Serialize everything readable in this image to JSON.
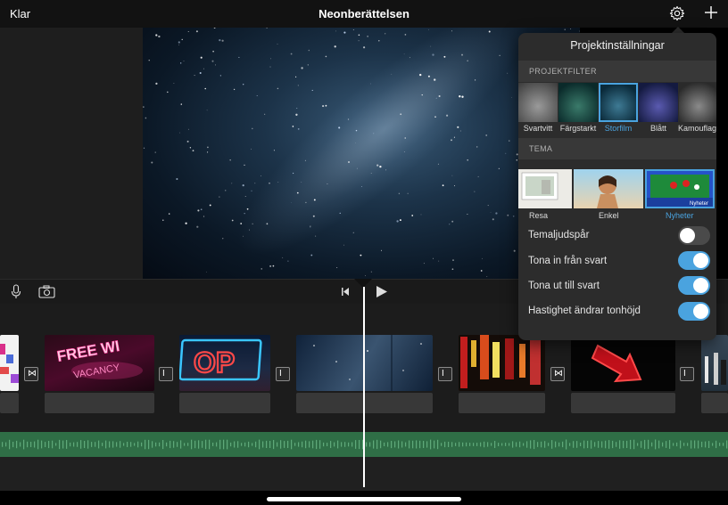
{
  "header": {
    "done_label": "Klar",
    "title": "Neonberättelsen",
    "settings_icon": "gear-icon",
    "add_icon": "plus-icon"
  },
  "controls": {
    "mic_icon": "microphone-icon",
    "camera_icon": "camera-icon",
    "skip_icon": "skip-to-start-icon",
    "play_icon": "play-icon"
  },
  "popover": {
    "title": "Projektinställningar",
    "filter_section": "PROJEKTFILTER",
    "filters": [
      {
        "label": "Svartvitt",
        "selected": false
      },
      {
        "label": "Färgstarkt",
        "selected": false
      },
      {
        "label": "Storfilm",
        "selected": true
      },
      {
        "label": "Blått",
        "selected": false
      },
      {
        "label": "Kamouflage",
        "selected": false
      }
    ],
    "theme_section": "TEMA",
    "themes": [
      {
        "label": "Resa",
        "selected": false
      },
      {
        "label": "Enkel",
        "selected": false
      },
      {
        "label": "Nyheter",
        "selected": true
      }
    ],
    "news_tag": "Nyheter",
    "settings": [
      {
        "label": "Temaljudspår",
        "on": false
      },
      {
        "label": "Tona in från svart",
        "on": true
      },
      {
        "label": "Tona ut till svart",
        "on": true
      },
      {
        "label": "Hastighet ändrar tonhöjd",
        "on": true
      }
    ]
  },
  "timeline": {
    "clips": [
      {
        "name": "clip-colorful-signs"
      },
      {
        "name": "clip-free-wifi-vacancy-neon",
        "text": "FREE WI"
      },
      {
        "name": "clip-open-neon-sign",
        "text": "OP"
      },
      {
        "name": "clip-milky-way"
      },
      {
        "name": "clip-city-night-street"
      },
      {
        "name": "clip-red-arrow-neon"
      },
      {
        "name": "clip-city-people"
      }
    ],
    "neon_text_2": "VACANCY",
    "transition_icons": [
      "crossfade-icon",
      "cut-icon",
      "cut-icon",
      "cut-icon",
      "crossfade-icon",
      "cut-icon"
    ],
    "accent": "#4aa3df",
    "audio_color": "#2f6e46"
  }
}
